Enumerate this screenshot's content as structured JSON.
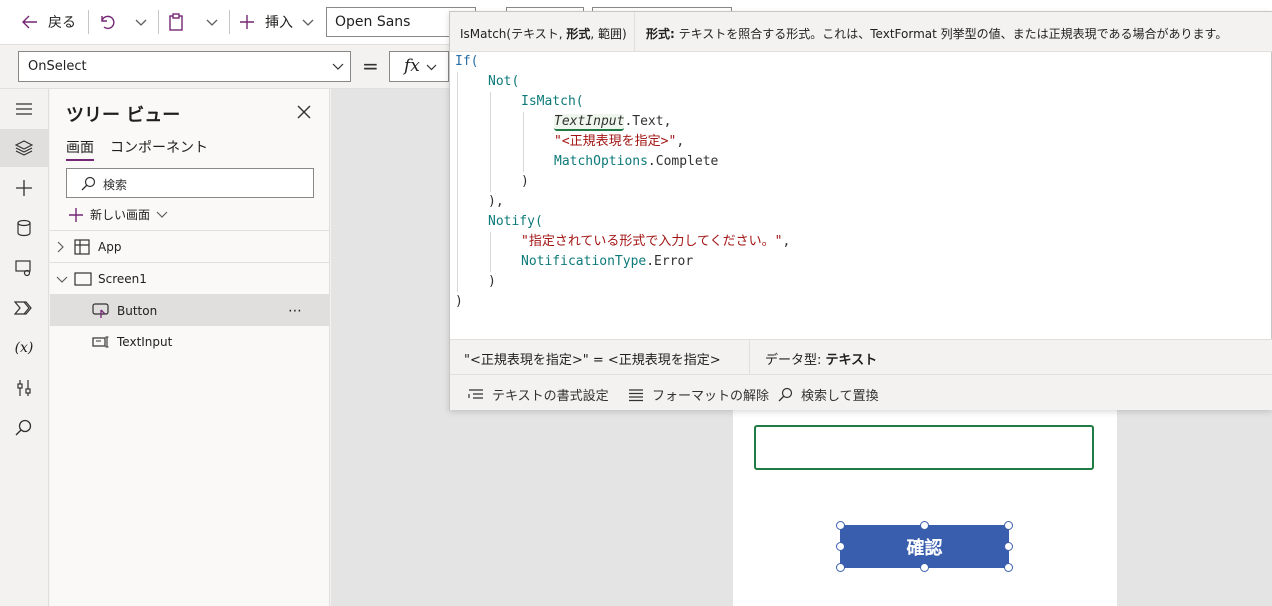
{
  "toolbar": {
    "back_label": "戻る",
    "insert_label": "挿入",
    "font_value": "Open Sans"
  },
  "formula_bar": {
    "property_value": "OnSelect",
    "fx_label": "fx",
    "equals": "="
  },
  "tree": {
    "title": "ツリー ビュー",
    "tabs": [
      "画面",
      "コンポーネント"
    ],
    "search_placeholder": "検索",
    "new_screen_label": "新しい画面",
    "items": [
      {
        "label": "App"
      },
      {
        "label": "Screen1"
      },
      {
        "label": "Button",
        "more": "⋯"
      },
      {
        "label": "TextInput"
      }
    ]
  },
  "editor": {
    "signature": {
      "prefix": "IsMatch(テキスト, ",
      "bold_param": "形式",
      "suffix": ", 範囲)"
    },
    "param_help": {
      "name": "形式:",
      "text": " テキストを照合する形式。これは、TextFormat 列挙型の値、または正規表現である場合があります。"
    },
    "code": {
      "l1": "If(",
      "l2": "Not(",
      "l3": "IsMatch(",
      "l4a": "TextInput",
      "l4b": ".Text,",
      "l5a": "\"<正規表現を指定>\"",
      "l5b": ",",
      "l6a": "MatchOptions",
      "l6b": ".Complete",
      "l7": ")",
      "l8": "),",
      "l9": "Notify(",
      "l10a": "\"指定されている形式で入力してください。\"",
      "l10b": ",",
      "l11a": "NotificationType",
      "l11b": ".Error",
      "l12": ")",
      "l13": ")"
    },
    "result": {
      "expression": "\"<正規表現を指定>\" = <正規表現を指定>",
      "type_label": "データ型: ",
      "type_value": "テキスト"
    },
    "tools": {
      "format_text": "テキストの書式設定",
      "remove_format": "フォーマットの解除",
      "find_replace": "検索して置換"
    }
  },
  "canvas": {
    "button_label": "確認"
  },
  "colors": {
    "accent": "#742774",
    "button": "#3a5eae",
    "input_border": "#1f7a44",
    "keyword": "#2b6ea3",
    "string": "#a31515"
  }
}
